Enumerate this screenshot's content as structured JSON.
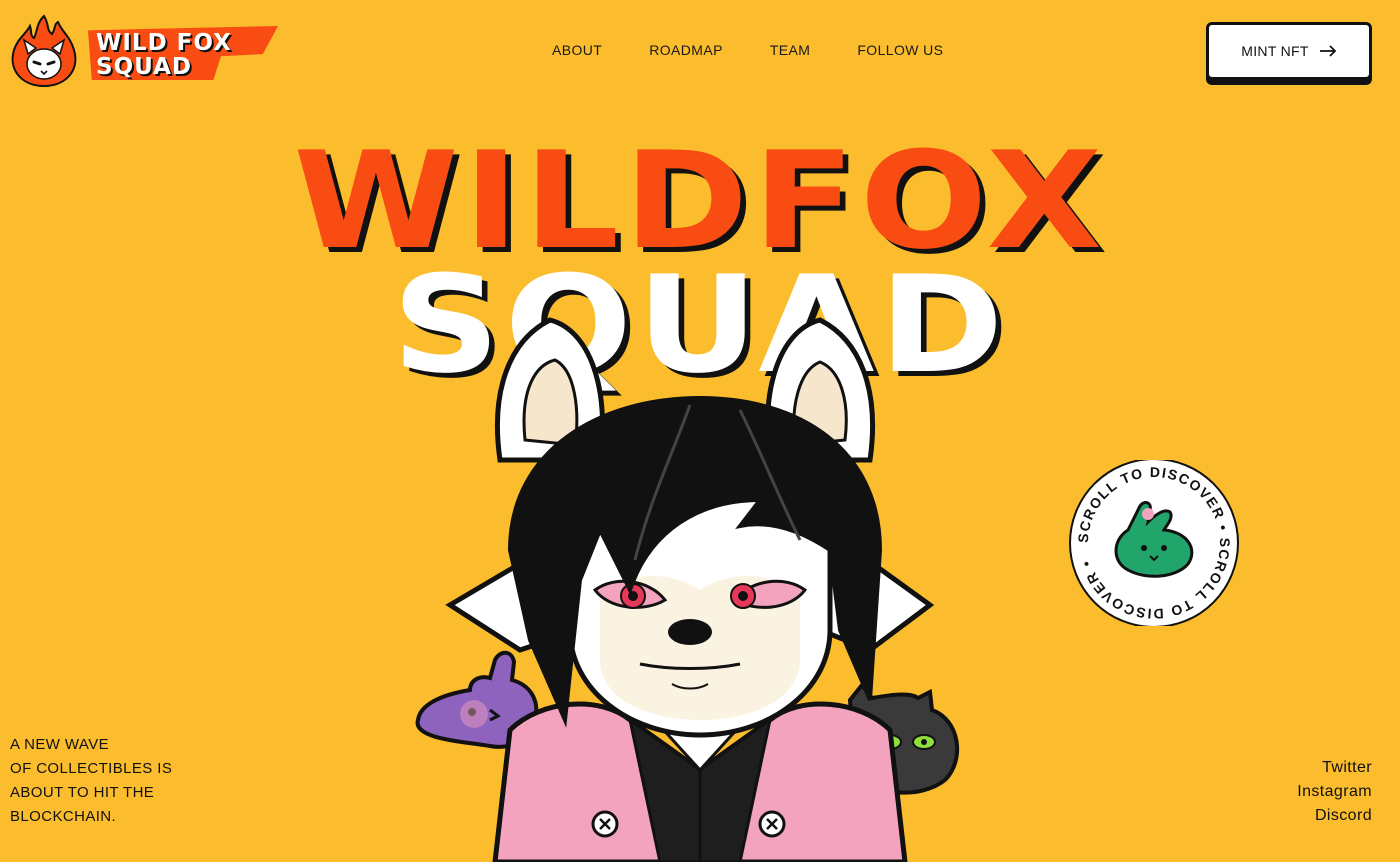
{
  "brand": {
    "logo_line1": "WILD FOX",
    "logo_line2": "SQUAD",
    "logo_icon": "fox-flame-icon"
  },
  "nav": {
    "items": [
      "ABOUT",
      "ROADMAP",
      "TEAM",
      "FOLLOW US"
    ]
  },
  "cta": {
    "label": "MINT NFT",
    "icon": "arrow-right-icon"
  },
  "hero": {
    "title_line1": "WILDFOX",
    "title_line2": "SQUAD",
    "character": "white-fox-character-with-black-hair-pink-jacket",
    "pets": [
      "purple-bunny-pet",
      "black-cat-pet"
    ]
  },
  "scroll_badge": {
    "text": "SCROLL TO DISCOVER • SCROLL TO DISCOVER •",
    "icon": "green-bunny-pet-icon"
  },
  "tagline": {
    "lines": [
      "A NEW WAVE",
      "OF COLLECTIBLES IS",
      "ABOUT TO HIT THE",
      "BLOCKCHAIN."
    ]
  },
  "socials": {
    "items": [
      "Twitter",
      "Instagram",
      "Discord"
    ]
  },
  "colors": {
    "background": "#FBBD2D",
    "accent": "#F84C12",
    "ink": "#111111",
    "white": "#FFFFFF",
    "jacket_pink": "#F3A3BE"
  }
}
